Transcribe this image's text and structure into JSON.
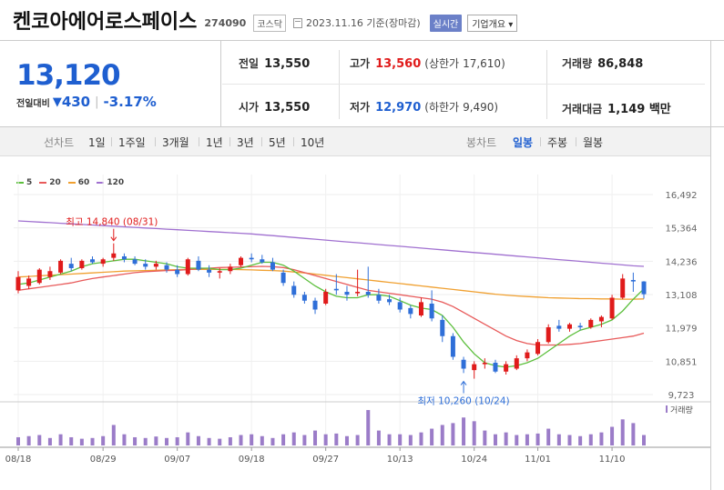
{
  "header": {
    "name": "켄코아에어로스페이스",
    "code": "274090",
    "market": "코스닥",
    "date": "2023.11.16 기준(장마감)",
    "realtime_label": "실시간",
    "overview_label": "기업개요 ▾"
  },
  "quote": {
    "price": "13,120",
    "change_label": "전일대비",
    "change_arrow": "▼",
    "change": "430",
    "change_pct": "-3.17%",
    "prev_close_label": "전일",
    "prev_close": "13,550",
    "open_label": "시가",
    "open": "13,550",
    "high_label": "고가",
    "high": "13,560",
    "upper_limit_label": "(상한가",
    "upper_limit": "17,610)",
    "low_label": "저가",
    "low": "12,970",
    "lower_limit_label": "(하한가",
    "lower_limit": "9,490)",
    "volume_label": "거래량",
    "volume": "86,848",
    "amount_label": "거래대금",
    "amount": "1,149 백만"
  },
  "period_bar": {
    "line_label": "선차트",
    "line_items": [
      "1일",
      "1주일",
      "3개월",
      "1년",
      "3년",
      "5년",
      "10년"
    ],
    "candle_label": "봉차트",
    "candle_items": [
      "일봉",
      "주봉",
      "월봉"
    ],
    "active_candle": 0
  },
  "legend": [
    {
      "label": "5",
      "color": "#5cbf3c"
    },
    {
      "label": "20",
      "color": "#e85a5a"
    },
    {
      "label": "60",
      "color": "#f0a030"
    },
    {
      "label": "120",
      "color": "#a070d0"
    }
  ],
  "colors": {
    "up": "#e01b1b",
    "down": "#2f6fd8",
    "volume": "#9b7cc8"
  },
  "chart_data": {
    "type": "candlestick",
    "y_ticks": [
      "16,492",
      "15,364",
      "14,236",
      "13,108",
      "11,979",
      "10,851",
      "9,723"
    ],
    "ylim": [
      9723,
      16492
    ],
    "x_ticks": [
      {
        "index": 0,
        "label": "08/18"
      },
      {
        "index": 8,
        "label": "08/29"
      },
      {
        "index": 15,
        "label": "09/07"
      },
      {
        "index": 22,
        "label": "09/18"
      },
      {
        "index": 29,
        "label": "09/27"
      },
      {
        "index": 36,
        "label": "10/13"
      },
      {
        "index": 43,
        "label": "10/24"
      },
      {
        "index": 49,
        "label": "11/01"
      },
      {
        "index": 56,
        "label": "11/10"
      }
    ],
    "volume_label": "거래량",
    "annotations": [
      {
        "text": "최고 14,840 (08/31)",
        "index": 9,
        "value": 14840,
        "type": "high"
      },
      {
        "text": "최저 10,260 (10/24)",
        "index": 42,
        "value": 10260,
        "type": "low"
      }
    ],
    "candles": [
      {
        "o": 13250,
        "h": 13900,
        "l": 13150,
        "c": 13700,
        "v": 0.22
      },
      {
        "o": 13400,
        "h": 13750,
        "l": 13300,
        "c": 13650,
        "v": 0.25
      },
      {
        "o": 13500,
        "h": 14000,
        "l": 13450,
        "c": 13950,
        "v": 0.28
      },
      {
        "o": 13700,
        "h": 14050,
        "l": 13600,
        "c": 13900,
        "v": 0.2
      },
      {
        "o": 13850,
        "h": 14300,
        "l": 13800,
        "c": 14250,
        "v": 0.3
      },
      {
        "o": 14150,
        "h": 14350,
        "l": 13900,
        "c": 14000,
        "v": 0.22
      },
      {
        "o": 14000,
        "h": 14300,
        "l": 13950,
        "c": 14250,
        "v": 0.18
      },
      {
        "o": 14300,
        "h": 14400,
        "l": 14150,
        "c": 14200,
        "v": 0.2
      },
      {
        "o": 14150,
        "h": 14350,
        "l": 14050,
        "c": 14300,
        "v": 0.25
      },
      {
        "o": 14350,
        "h": 14840,
        "l": 14250,
        "c": 14500,
        "v": 0.55
      },
      {
        "o": 14400,
        "h": 14500,
        "l": 14200,
        "c": 14300,
        "v": 0.3
      },
      {
        "o": 14300,
        "h": 14400,
        "l": 14100,
        "c": 14150,
        "v": 0.22
      },
      {
        "o": 14150,
        "h": 14300,
        "l": 13950,
        "c": 14050,
        "v": 0.2
      },
      {
        "o": 14050,
        "h": 14250,
        "l": 13950,
        "c": 14150,
        "v": 0.24
      },
      {
        "o": 14100,
        "h": 14200,
        "l": 13850,
        "c": 13950,
        "v": 0.2
      },
      {
        "o": 13950,
        "h": 14100,
        "l": 13700,
        "c": 13800,
        "v": 0.22
      },
      {
        "o": 13800,
        "h": 14350,
        "l": 13750,
        "c": 14300,
        "v": 0.35
      },
      {
        "o": 14250,
        "h": 14400,
        "l": 13900,
        "c": 13950,
        "v": 0.25
      },
      {
        "o": 13950,
        "h": 14100,
        "l": 13700,
        "c": 13850,
        "v": 0.2
      },
      {
        "o": 13850,
        "h": 14000,
        "l": 13650,
        "c": 13900,
        "v": 0.18
      },
      {
        "o": 13900,
        "h": 14150,
        "l": 13800,
        "c": 14050,
        "v": 0.22
      },
      {
        "o": 14100,
        "h": 14400,
        "l": 14050,
        "c": 14350,
        "v": 0.28
      },
      {
        "o": 14350,
        "h": 14500,
        "l": 14200,
        "c": 14300,
        "v": 0.3
      },
      {
        "o": 14300,
        "h": 14450,
        "l": 14150,
        "c": 14200,
        "v": 0.25
      },
      {
        "o": 14200,
        "h": 14350,
        "l": 13900,
        "c": 13950,
        "v": 0.2
      },
      {
        "o": 13850,
        "h": 13950,
        "l": 13400,
        "c": 13500,
        "v": 0.3
      },
      {
        "o": 13400,
        "h": 13550,
        "l": 13000,
        "c": 13100,
        "v": 0.35
      },
      {
        "o": 13100,
        "h": 13200,
        "l": 12800,
        "c": 12900,
        "v": 0.28
      },
      {
        "o": 12900,
        "h": 13000,
        "l": 12450,
        "c": 12600,
        "v": 0.4
      },
      {
        "o": 12800,
        "h": 13300,
        "l": 12750,
        "c": 13200,
        "v": 0.3
      },
      {
        "o": 13300,
        "h": 13800,
        "l": 13100,
        "c": 13250,
        "v": 0.32
      },
      {
        "o": 13200,
        "h": 13400,
        "l": 12900,
        "c": 13100,
        "v": 0.25
      },
      {
        "o": 13150,
        "h": 13950,
        "l": 13050,
        "c": 13200,
        "v": 0.28
      },
      {
        "o": 13200,
        "h": 14050,
        "l": 13000,
        "c": 13100,
        "v": 0.95
      },
      {
        "o": 13100,
        "h": 13300,
        "l": 12800,
        "c": 12900,
        "v": 0.4
      },
      {
        "o": 12950,
        "h": 13100,
        "l": 12750,
        "c": 12850,
        "v": 0.3
      },
      {
        "o": 12850,
        "h": 13000,
        "l": 12500,
        "c": 12600,
        "v": 0.3
      },
      {
        "o": 12650,
        "h": 12750,
        "l": 12300,
        "c": 12450,
        "v": 0.28
      },
      {
        "o": 12400,
        "h": 13000,
        "l": 12350,
        "c": 12850,
        "v": 0.35
      },
      {
        "o": 12800,
        "h": 13250,
        "l": 12200,
        "c": 12300,
        "v": 0.45
      },
      {
        "o": 12250,
        "h": 12400,
        "l": 11500,
        "c": 11700,
        "v": 0.55
      },
      {
        "o": 11700,
        "h": 11800,
        "l": 10900,
        "c": 11000,
        "v": 0.6
      },
      {
        "o": 10900,
        "h": 11000,
        "l": 10450,
        "c": 10600,
        "v": 0.75
      },
      {
        "o": 10550,
        "h": 10850,
        "l": 10260,
        "c": 10750,
        "v": 0.65
      },
      {
        "o": 10750,
        "h": 10950,
        "l": 10600,
        "c": 10800,
        "v": 0.4
      },
      {
        "o": 10800,
        "h": 10900,
        "l": 10450,
        "c": 10500,
        "v": 0.3
      },
      {
        "o": 10500,
        "h": 10850,
        "l": 10400,
        "c": 10750,
        "v": 0.35
      },
      {
        "o": 10600,
        "h": 11050,
        "l": 10550,
        "c": 10950,
        "v": 0.28
      },
      {
        "o": 10950,
        "h": 11250,
        "l": 10850,
        "c": 11150,
        "v": 0.3
      },
      {
        "o": 11100,
        "h": 11600,
        "l": 11050,
        "c": 11500,
        "v": 0.32
      },
      {
        "o": 11500,
        "h": 12100,
        "l": 11450,
        "c": 12000,
        "v": 0.45
      },
      {
        "o": 12050,
        "h": 12250,
        "l": 11850,
        "c": 11950,
        "v": 0.3
      },
      {
        "o": 11950,
        "h": 12150,
        "l": 11850,
        "c": 12100,
        "v": 0.28
      },
      {
        "o": 12050,
        "h": 12150,
        "l": 11900,
        "c": 12000,
        "v": 0.25
      },
      {
        "o": 12000,
        "h": 12300,
        "l": 11950,
        "c": 12250,
        "v": 0.3
      },
      {
        "o": 12200,
        "h": 12400,
        "l": 12000,
        "c": 12350,
        "v": 0.35
      },
      {
        "o": 12300,
        "h": 13100,
        "l": 12250,
        "c": 13000,
        "v": 0.5
      },
      {
        "o": 13000,
        "h": 13800,
        "l": 12950,
        "c": 13650,
        "v": 0.7
      },
      {
        "o": 13600,
        "h": 13850,
        "l": 13200,
        "c": 13550,
        "v": 0.6
      },
      {
        "o": 13550,
        "h": 13560,
        "l": 12970,
        "c": 13120,
        "v": 0.28
      }
    ],
    "ma": {
      "5": [
        13450,
        13500,
        13600,
        13700,
        13800,
        13900,
        14050,
        14150,
        14200,
        14250,
        14300,
        14300,
        14250,
        14200,
        14150,
        14050,
        14000,
        14000,
        14000,
        13950,
        13950,
        14000,
        14100,
        14200,
        14200,
        14100,
        13900,
        13650,
        13400,
        13200,
        13050,
        13000,
        13000,
        13100,
        13100,
        13050,
        12900,
        12750,
        12650,
        12600,
        12400,
        12000,
        11500,
        11100,
        10800,
        10700,
        10650,
        10700,
        10800,
        10950,
        11200,
        11450,
        11700,
        11900,
        12000,
        12100,
        12250,
        12550,
        12950,
        13300
      ],
      "20": [
        13250,
        13300,
        13350,
        13400,
        13450,
        13500,
        13580,
        13650,
        13700,
        13750,
        13800,
        13850,
        13880,
        13900,
        13920,
        13930,
        13950,
        13980,
        14000,
        14020,
        14030,
        14040,
        14050,
        14060,
        14050,
        14020,
        13950,
        13850,
        13750,
        13650,
        13550,
        13450,
        13350,
        13250,
        13200,
        13150,
        13100,
        13050,
        13000,
        12950,
        12850,
        12700,
        12500,
        12300,
        12100,
        11900,
        11700,
        11550,
        11450,
        11400,
        11400,
        11400,
        11420,
        11450,
        11500,
        11550,
        11600,
        11650,
        11700,
        11800
      ],
      "60": [
        13700,
        13720,
        13740,
        13760,
        13780,
        13800,
        13820,
        13840,
        13860,
        13880,
        13900,
        13910,
        13920,
        13930,
        13940,
        13950,
        13960,
        13960,
        13960,
        13960,
        13960,
        13950,
        13940,
        13930,
        13920,
        13900,
        13870,
        13840,
        13800,
        13760,
        13720,
        13680,
        13640,
        13600,
        13560,
        13520,
        13480,
        13440,
        13400,
        13360,
        13320,
        13280,
        13240,
        13200,
        13160,
        13120,
        13090,
        13060,
        13040,
        13020,
        13000,
        12990,
        12980,
        12970,
        12970,
        12960,
        12960,
        12950,
        12950,
        12960
      ],
      "120": [
        15600,
        15580,
        15560,
        15540,
        15520,
        15500,
        15480,
        15460,
        15440,
        15420,
        15400,
        15380,
        15360,
        15340,
        15320,
        15300,
        15280,
        15260,
        15240,
        15220,
        15200,
        15180,
        15160,
        15130,
        15100,
        15070,
        15040,
        15010,
        14980,
        14950,
        14920,
        14890,
        14860,
        14830,
        14800,
        14770,
        14740,
        14710,
        14680,
        14650,
        14620,
        14590,
        14560,
        14530,
        14500,
        14470,
        14440,
        14410,
        14380,
        14350,
        14320,
        14290,
        14260,
        14230,
        14200,
        14170,
        14140,
        14110,
        14080,
        14060
      ]
    }
  }
}
